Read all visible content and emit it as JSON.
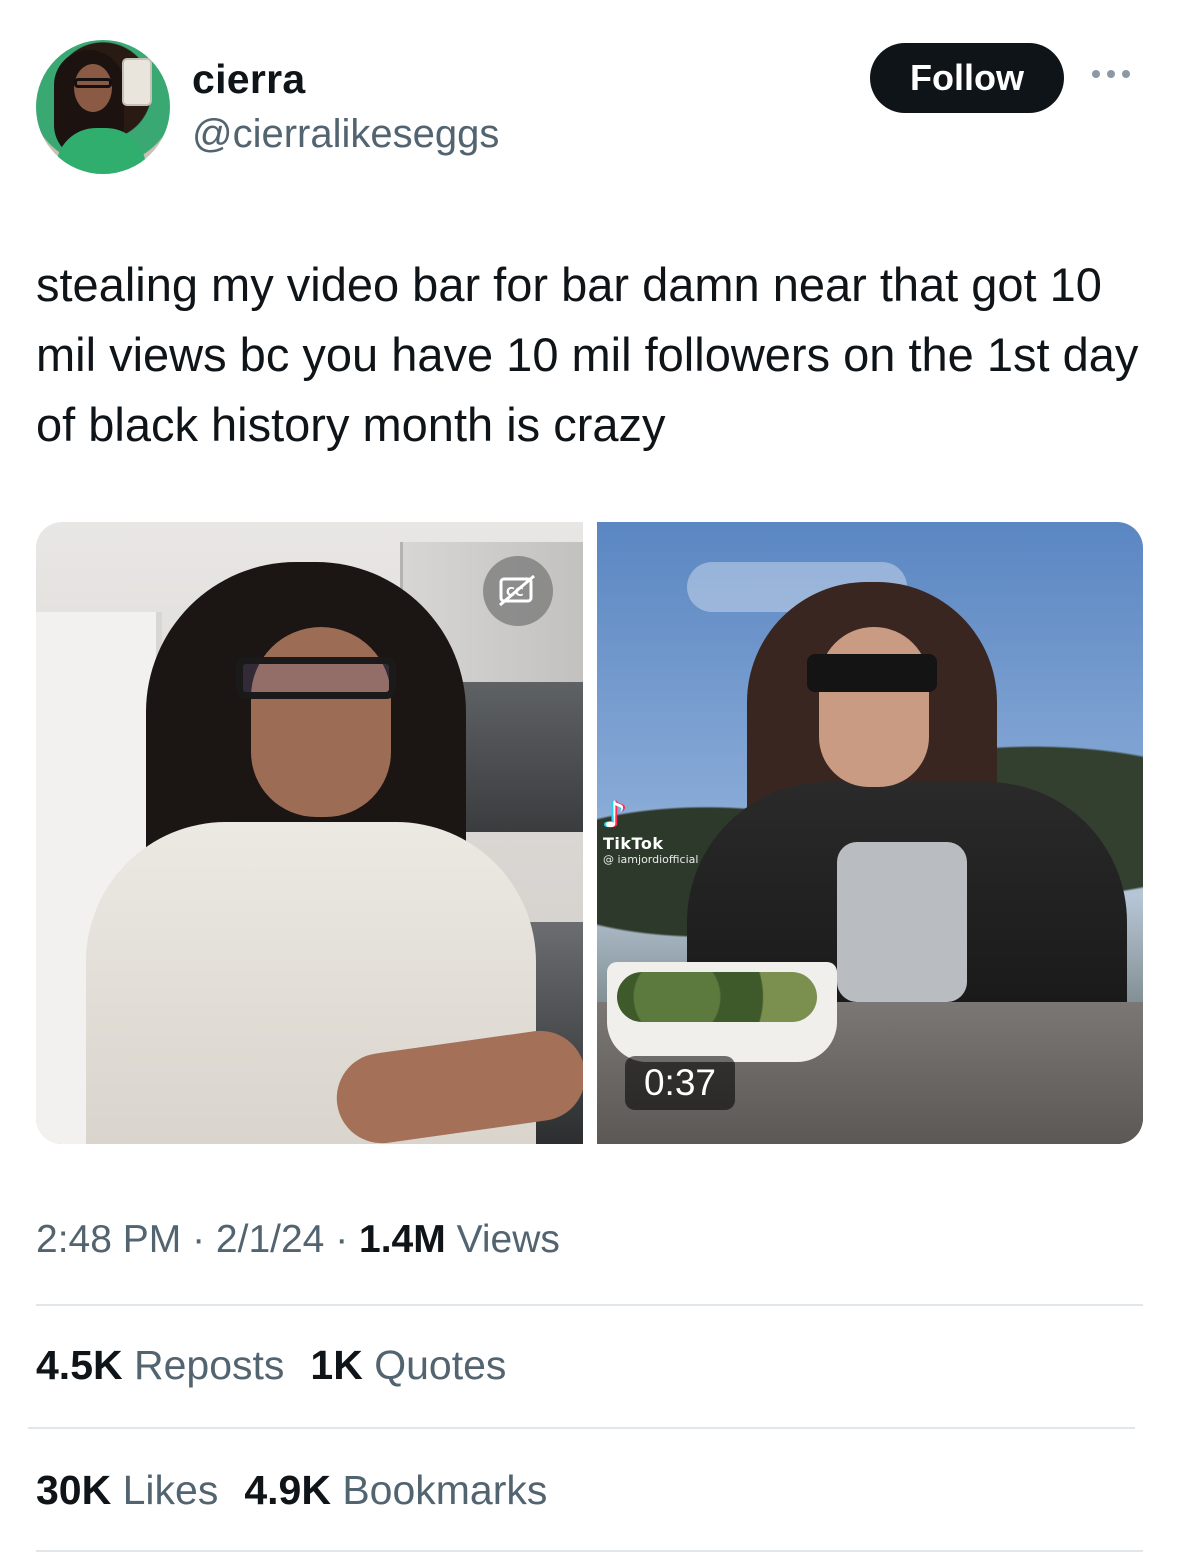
{
  "user": {
    "name": "cierra",
    "handle": "@cierralikeseggs",
    "follow_label": "Follow"
  },
  "tweet": {
    "text": "stealing my video bar for bar damn near that got 10 mil views bc you have 10 mil followers on the 1st day of black history month is crazy"
  },
  "media": {
    "right_video": {
      "watermark_brand": "TikTok",
      "watermark_user": "@ iamjordiofficial",
      "duration": "0:37"
    }
  },
  "meta": {
    "time": "2:48 PM",
    "sep1": " · ",
    "date": "2/1/24",
    "sep2": " · ",
    "views_count": "1.4M",
    "views_label": " Views"
  },
  "stats": {
    "reposts_count": "4.5K",
    "reposts_label": " Reposts",
    "quotes_count": "1K",
    "quotes_label": " Quotes",
    "likes_count": "30K",
    "likes_label": " Likes",
    "bookmarks_count": "4.9K",
    "bookmarks_label": " Bookmarks"
  },
  "icons": {
    "more": "more-horizontal-icon",
    "captions_off": "closed-captions-off-icon",
    "tiktok": "tiktok-logo-icon"
  },
  "colors": {
    "text_primary": "#0f1419",
    "text_secondary": "#536471",
    "follow_bg": "#0f1419",
    "divider": "#e1e6ea"
  }
}
